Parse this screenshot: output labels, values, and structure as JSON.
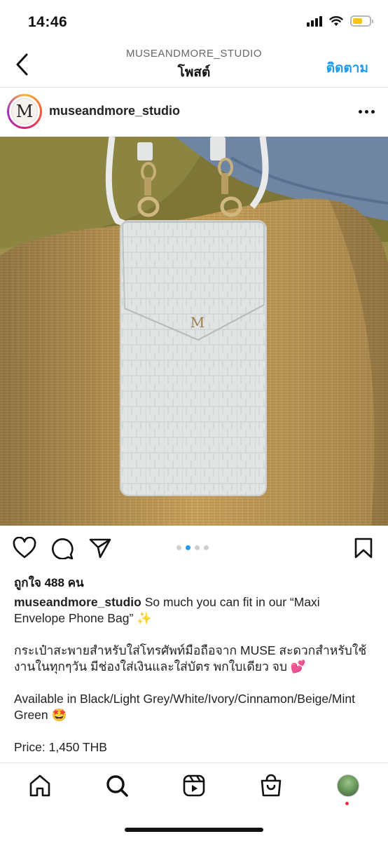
{
  "status_bar": {
    "time": "14:46"
  },
  "header": {
    "username": "MUSEANDMORE_STUDIO",
    "title": "โพสต์",
    "follow_label": "ติดตาม"
  },
  "post": {
    "avatar_letter": "M",
    "username": "museandmore_studio",
    "photo": {
      "bag_logo": "M"
    },
    "carousel": {
      "count": 4,
      "active_index": 1
    },
    "likes": "ถูกใจ 488 คน",
    "caption": {
      "username": "museandmore_studio",
      "line1": "So much you can fit in our “Maxi Envelope Phone Bag” ✨",
      "line2": "กระเป๋าสะพายสำหรับใส่โทรศัพท์มือถือจาก MUSE สะดวกสำหรับใช้งานในทุกๆวัน มีช่องใส่เงินและใส่บัตร พกใบเดียว จบ 💕",
      "line3": "Available in Black/Light Grey/White/Ivory/Cinnamon/Beige/Mint Green 🤩",
      "line4": "Price: 1,450 THB"
    }
  },
  "icons": {
    "back": "chevron-left-icon",
    "more": "more-horizontal-icon",
    "like": "heart-icon",
    "comment": "comment-icon",
    "share": "send-icon",
    "save": "bookmark-icon",
    "nav": [
      "home-icon",
      "search-icon",
      "reels-icon",
      "shop-icon",
      "profile-avatar"
    ]
  },
  "colors": {
    "accent": "#1c9bef",
    "notification": "#e8323c"
  }
}
